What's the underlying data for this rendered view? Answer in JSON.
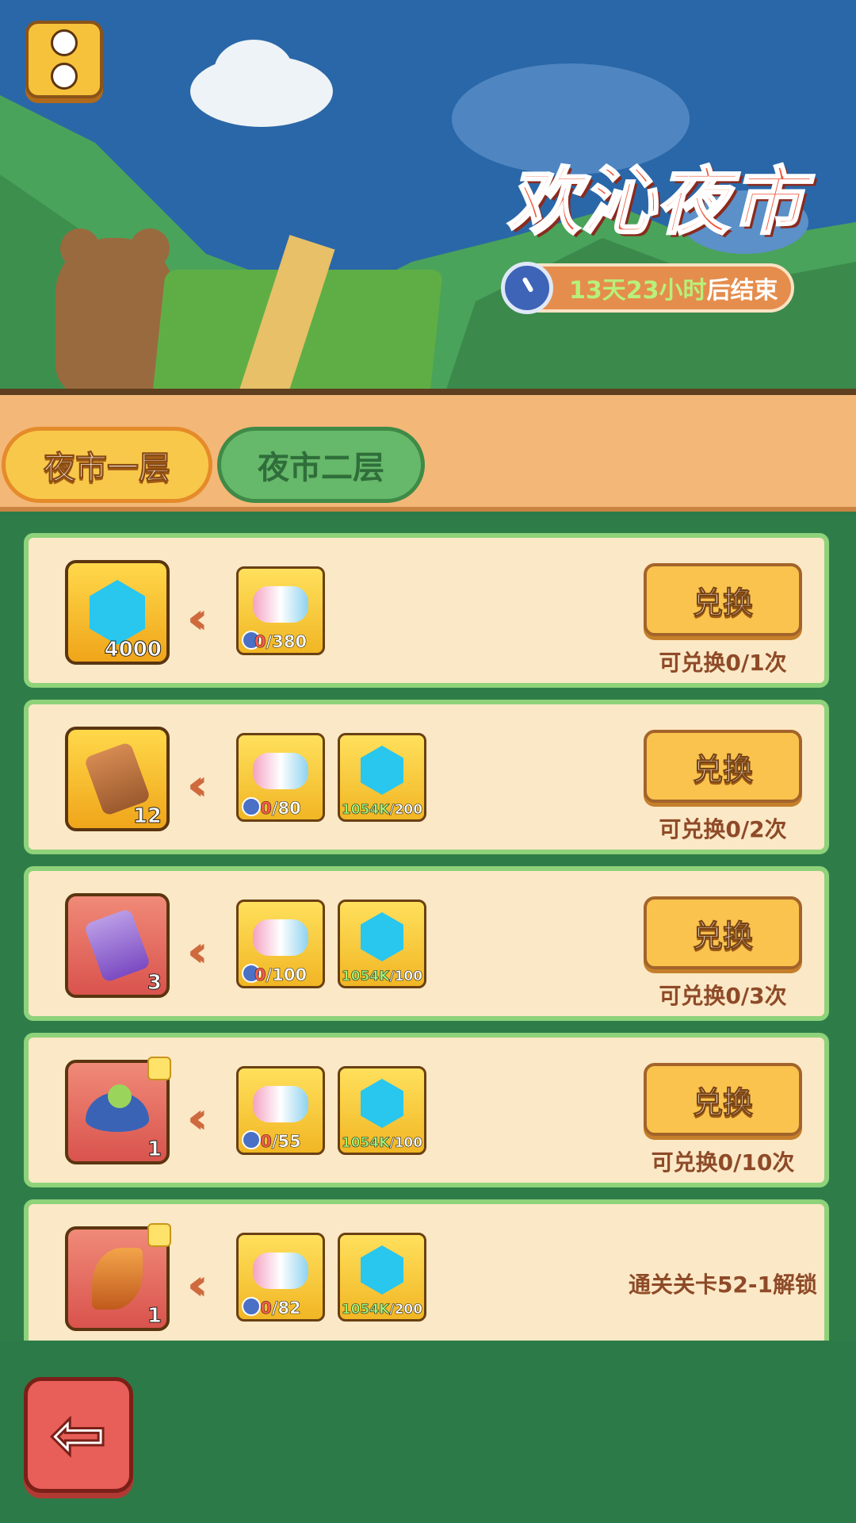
{
  "header": {
    "title": "欢沁夜市",
    "timer_highlight": "13天23小时",
    "timer_suffix": "后结束"
  },
  "tabs": [
    {
      "label": "夜市一层",
      "active": true
    },
    {
      "label": "夜市二层",
      "active": false
    }
  ],
  "rows": [
    {
      "reward": {
        "icon": "gem-icon",
        "count": "4000",
        "frame": "gold"
      },
      "costs": [
        {
          "icon": "marshmallow-icon",
          "have": "0",
          "need": "/380"
        }
      ],
      "button": "兑换",
      "limit": "可兑换0/1次"
    },
    {
      "reward": {
        "icon": "scroll-icon",
        "count": "12",
        "frame": "gold"
      },
      "costs": [
        {
          "icon": "marshmallow-icon",
          "have": "0",
          "need": "/80"
        },
        {
          "icon": "gem-icon",
          "have": "1054K",
          "need": "/200"
        }
      ],
      "button": "兑换",
      "limit": "可兑换0/2次"
    },
    {
      "reward": {
        "icon": "purple-scroll-icon",
        "count": "3",
        "frame": "red"
      },
      "costs": [
        {
          "icon": "marshmallow-icon",
          "have": "0",
          "need": "/100"
        },
        {
          "icon": "gem-icon",
          "have": "1054K",
          "need": "/100"
        }
      ],
      "button": "兑换",
      "limit": "可兑换0/3次"
    },
    {
      "reward": {
        "icon": "seed-pod-icon",
        "count": "1",
        "frame": "red"
      },
      "costs": [
        {
          "icon": "marshmallow-icon",
          "have": "0",
          "need": "/55"
        },
        {
          "icon": "gem-icon",
          "have": "1054K",
          "need": "/100"
        }
      ],
      "button": "兑换",
      "limit": "可兑换0/10次"
    },
    {
      "reward": {
        "icon": "amber-leaf-icon",
        "count": "1",
        "frame": "red"
      },
      "costs": [
        {
          "icon": "marshmallow-icon",
          "have": "0",
          "need": "/82"
        },
        {
          "icon": "gem-icon",
          "have": "1054K",
          "need": "/200"
        }
      ],
      "locked_text": "通关关卡52-1解锁"
    }
  ],
  "colors": {
    "accent_gold": "#f9c34e",
    "list_green": "#2e7d49",
    "text_brown": "#8e4a28"
  }
}
